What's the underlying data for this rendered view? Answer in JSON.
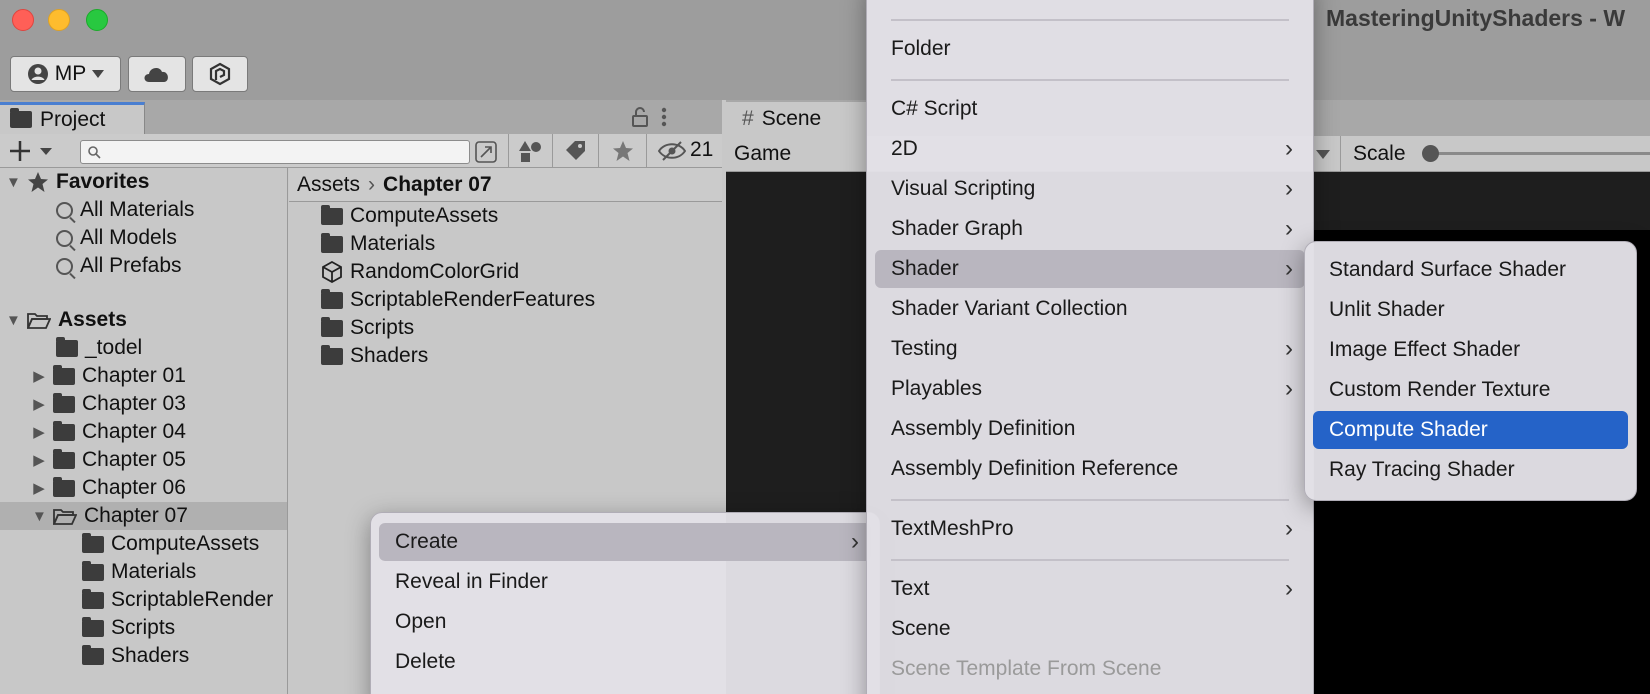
{
  "window": {
    "title": "MasteringUnityShaders - W"
  },
  "toolbar": {
    "account_label": "MP"
  },
  "project_panel": {
    "tab_label": "Project",
    "hidden_count": "21",
    "search": {
      "placeholder": ""
    },
    "tree": {
      "favorites_label": "Favorites",
      "favorites": [
        "All Materials",
        "All Models",
        "All Prefabs"
      ],
      "assets_label": "Assets",
      "folders": [
        "_todel",
        "Chapter 01",
        "Chapter 03",
        "Chapter 04",
        "Chapter 05",
        "Chapter 06",
        "Chapter 07"
      ],
      "chapter07_children": [
        "ComputeAssets",
        "Materials",
        "ScriptableRender",
        "Scripts",
        "Shaders"
      ]
    },
    "breadcrumb": {
      "root": "Assets",
      "current": "Chapter 07"
    },
    "assets": [
      "ComputeAssets",
      "Materials",
      "RandomColorGrid",
      "ScriptableRenderFeatures",
      "Scripts",
      "Shaders"
    ]
  },
  "scene_panel": {
    "scene_tab": "Scene",
    "game_label": "Game",
    "scale_label": "Scale"
  },
  "context_menu": {
    "items": [
      "Create",
      "Reveal in Finder",
      "Open",
      "Delete"
    ]
  },
  "create_menu": {
    "items": [
      "Folder",
      "C# Script",
      "2D",
      "Visual Scripting",
      "Shader Graph",
      "Shader",
      "Shader Variant Collection",
      "Testing",
      "Playables",
      "Assembly Definition",
      "Assembly Definition Reference",
      "TextMeshPro",
      "Text",
      "Scene",
      "Scene Template From Scene"
    ]
  },
  "shader_menu": {
    "items": [
      "Standard Surface Shader",
      "Unlit Shader",
      "Image Effect Shader",
      "Custom Render Texture",
      "Compute Shader",
      "Ray Tracing Shader"
    ],
    "selected": "Compute Shader"
  },
  "colors": {
    "selection": "#2563c8",
    "close": "#ff5f57",
    "minimize": "#febc2e",
    "maximize": "#28c840"
  }
}
